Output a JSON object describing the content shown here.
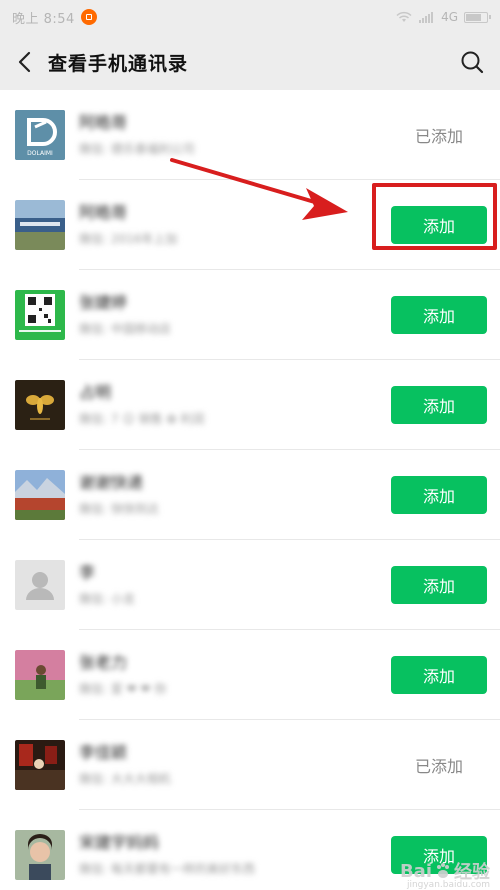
{
  "status_bar": {
    "time": "晚上 8:54",
    "network": "4G"
  },
  "header": {
    "title": "查看手机通讯录"
  },
  "contacts": [
    {
      "name": "阿皓哥",
      "subtitle": "微信: 德乐泰福利公司",
      "action": "已添加",
      "action_type": "added",
      "avatar": "dolaimi-logo",
      "avatar_text": "DOLAIMI"
    },
    {
      "name": "阿皓哥",
      "subtitle": "微信: 2016年上加",
      "action": "添加",
      "action_type": "add",
      "avatar": "building-photo"
    },
    {
      "name": "张婕婷",
      "subtitle": "微信: 中国移动店",
      "action": "添加",
      "action_type": "add",
      "avatar": "qr-code"
    },
    {
      "name": "占明",
      "subtitle": "微信: 7 ☺ 销售 ✿ 利润",
      "action": "添加",
      "action_type": "add",
      "avatar": "bee-logo"
    },
    {
      "name": "谢谢快递",
      "subtitle": "微信: 快快到达",
      "action": "添加",
      "action_type": "add",
      "avatar": "landscape-photo"
    },
    {
      "name": "李",
      "subtitle": "微信: 小龙",
      "action": "添加",
      "action_type": "add",
      "avatar": "default-avatar"
    },
    {
      "name": "张老力",
      "subtitle": "微信: 爱 ❤ ❤ 你",
      "action": "添加",
      "action_type": "add",
      "avatar": "person-flowers-photo"
    },
    {
      "name": "李佳颖",
      "subtitle": "微信: 大大大相机",
      "action": "已添加",
      "action_type": "added",
      "avatar": "lantern-photo"
    },
    {
      "name": "宋建宇妈妈",
      "subtitle": "微信: 每天都要有一样的美好东西",
      "action": "添加",
      "action_type": "add",
      "avatar": "woman-portrait-photo"
    }
  ],
  "watermark": {
    "brand": "Bai",
    "suffix": "经验",
    "url": "jingyan.baidu.com"
  },
  "colors": {
    "add_button": "#07c160",
    "highlight": "#d81e1e",
    "header_bg": "#ededed"
  }
}
